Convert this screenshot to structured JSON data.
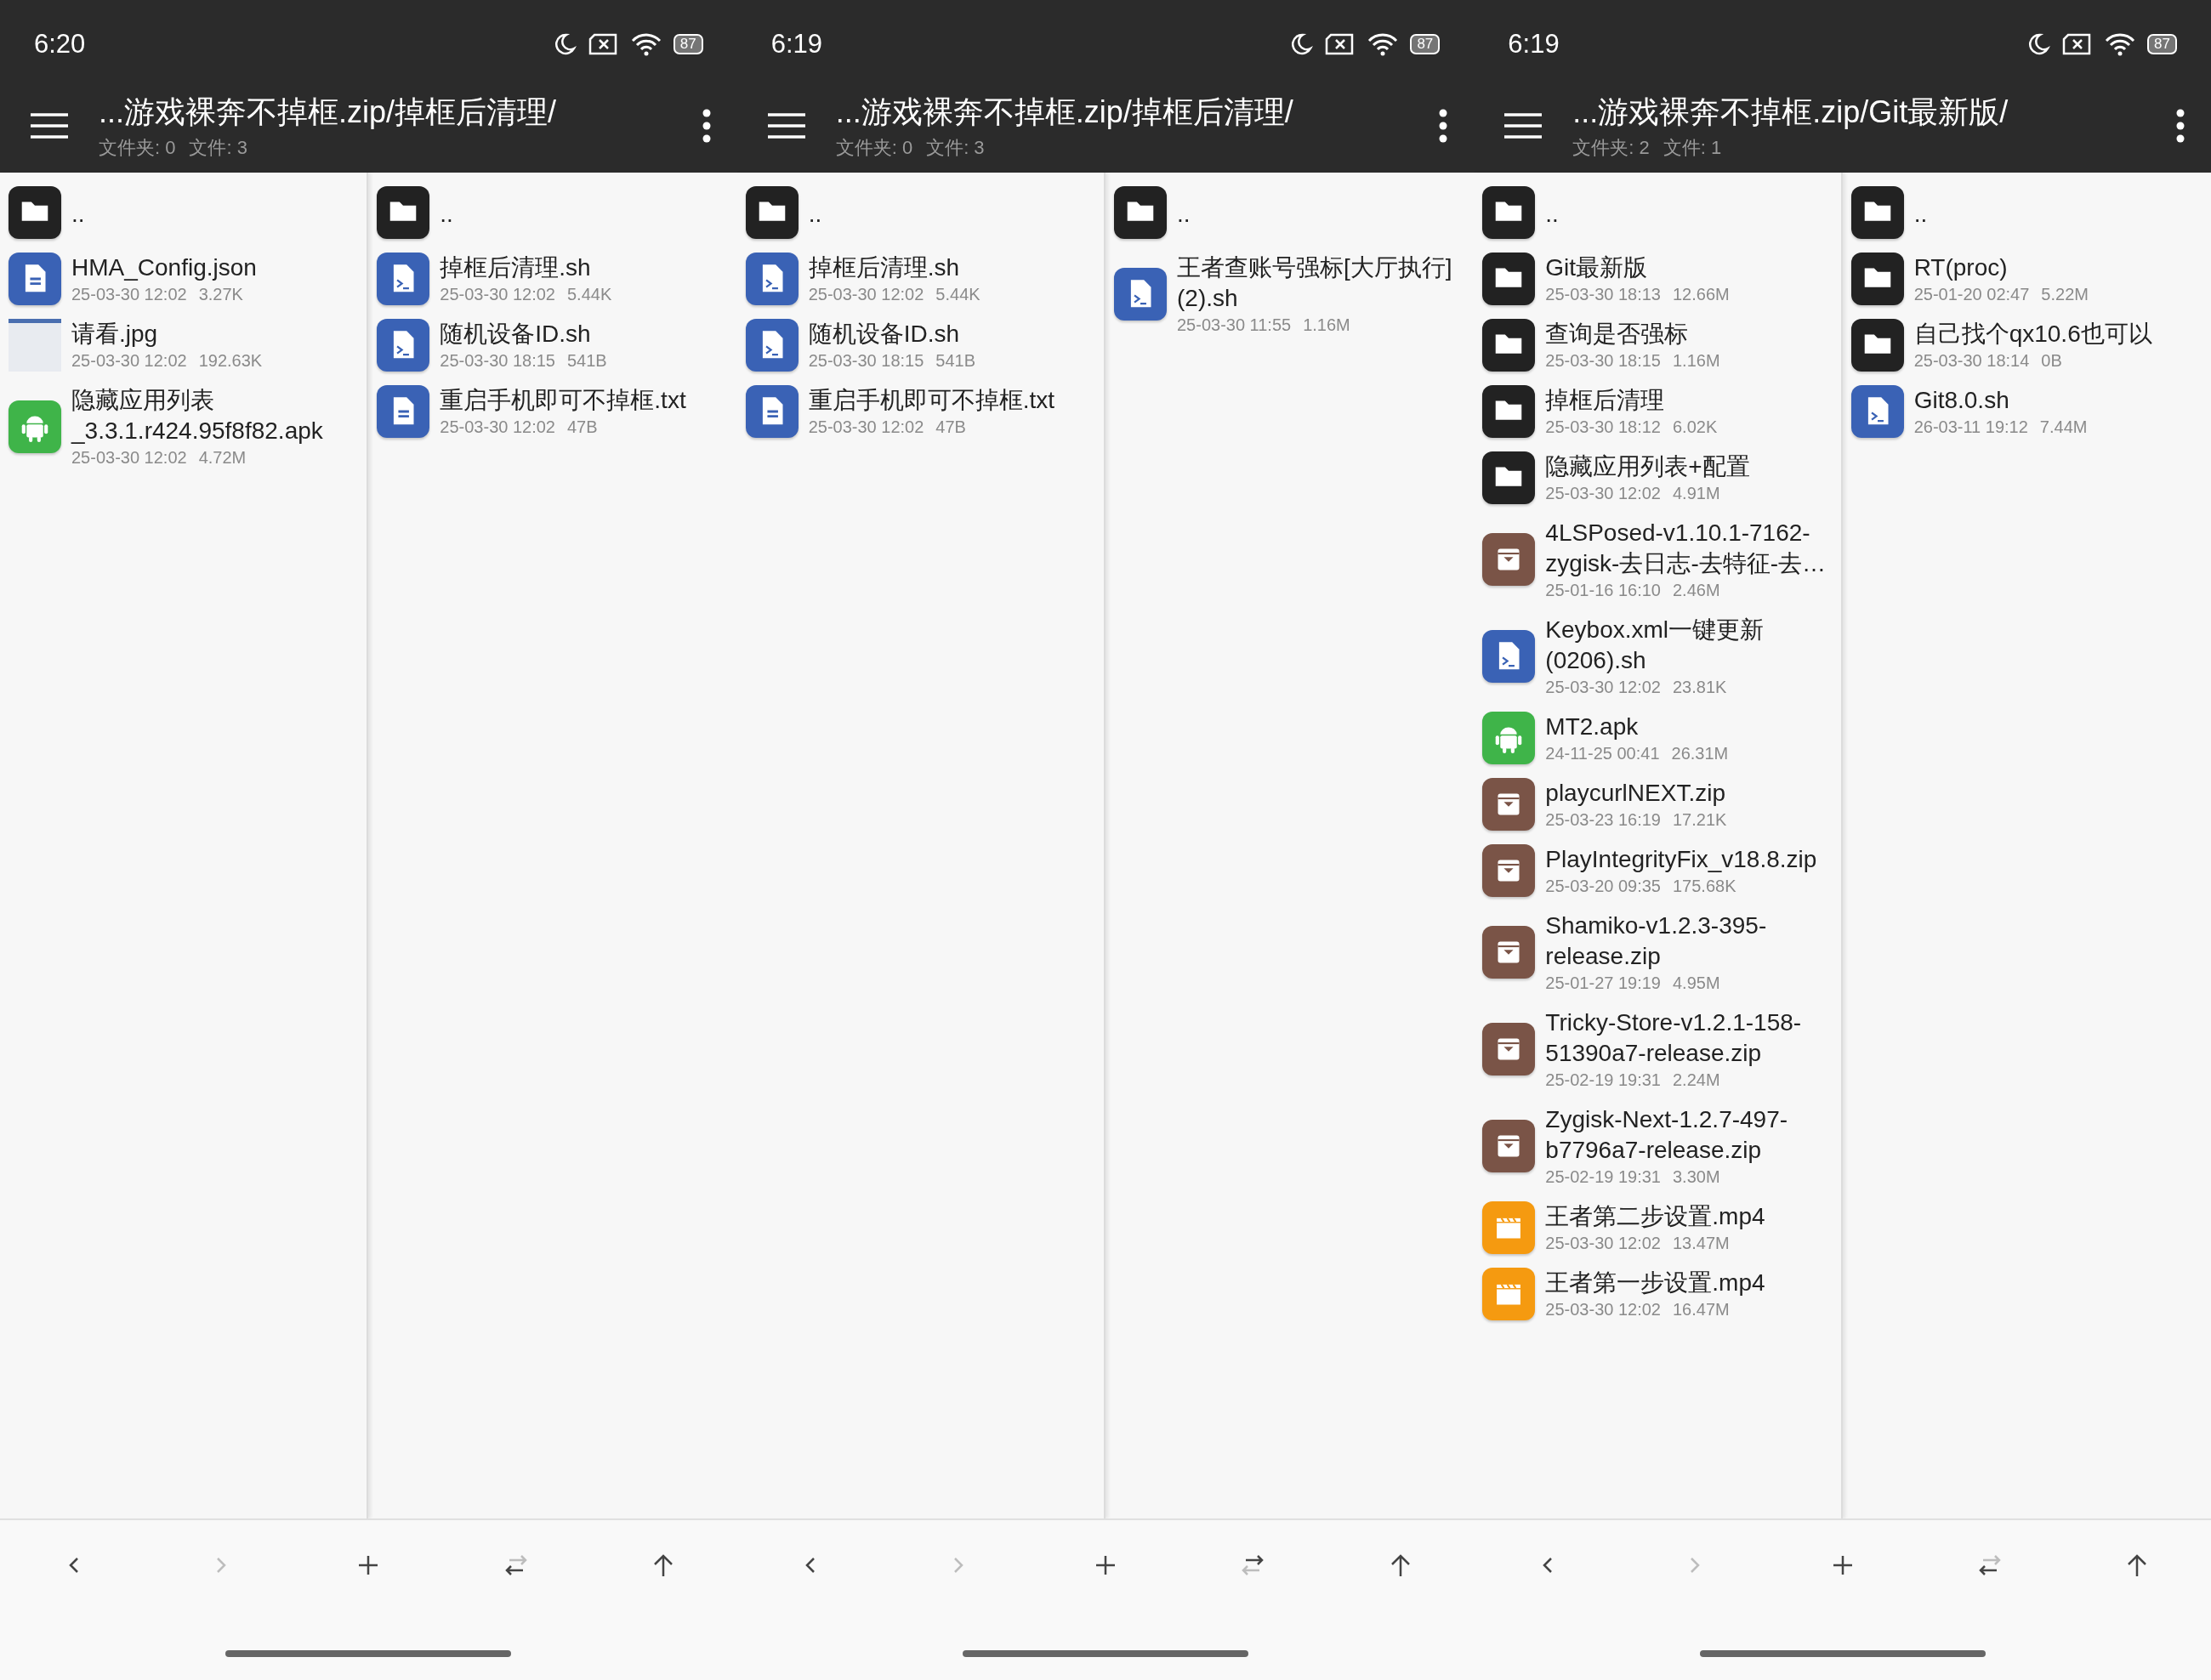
{
  "screens": [
    {
      "status_bar": {
        "time": "6:20",
        "battery": "87"
      },
      "toolbar": {
        "title": "...游戏裸奔不掉框.zip/掉框后清理/",
        "folders": "文件夹: 0",
        "files": "文件: 3"
      },
      "panes": [
        {
          "files": [
            {
              "name": "..",
              "kind": "folder"
            },
            {
              "name": "HMA_Config.json",
              "kind": "doc",
              "date": "25-03-30 12:02",
              "size": "3.27K"
            },
            {
              "name": "请看.jpg",
              "kind": "image",
              "date": "25-03-30 12:02",
              "size": "192.63K"
            },
            {
              "name": "隐藏应用列表_3.3.1.r424.95f8f82.apk",
              "kind": "apk",
              "date": "25-03-30 12:02",
              "size": "4.72M"
            }
          ]
        },
        {
          "files": [
            {
              "name": "..",
              "kind": "folder"
            },
            {
              "name": "掉框后清理.sh",
              "kind": "script",
              "date": "25-03-30 12:02",
              "size": "5.44K"
            },
            {
              "name": "随机设备ID.sh",
              "kind": "script",
              "date": "25-03-30 18:15",
              "size": "541B"
            },
            {
              "name": "重启手机即可不掉框.txt",
              "kind": "doc",
              "date": "25-03-30 12:02",
              "size": "47B"
            }
          ]
        }
      ],
      "nav": [
        {
          "kind": "back",
          "disabled": false
        },
        {
          "kind": "forward",
          "disabled": true
        },
        {
          "kind": "add"
        },
        {
          "kind": "swap",
          "right_pane_active": true
        },
        {
          "kind": "up"
        }
      ]
    },
    {
      "status_bar": {
        "time": "6:19",
        "battery": "87"
      },
      "toolbar": {
        "title": "...游戏裸奔不掉框.zip/掉框后清理/",
        "folders": "文件夹: 0",
        "files": "文件: 3"
      },
      "panes": [
        {
          "files": [
            {
              "name": "..",
              "kind": "folder"
            },
            {
              "name": "掉框后清理.sh",
              "kind": "script",
              "date": "25-03-30 12:02",
              "size": "5.44K"
            },
            {
              "name": "随机设备ID.sh",
              "kind": "script",
              "date": "25-03-30 18:15",
              "size": "541B"
            },
            {
              "name": "重启手机即可不掉框.txt",
              "kind": "doc",
              "date": "25-03-30 12:02",
              "size": "47B"
            }
          ]
        },
        {
          "files": [
            {
              "name": "..",
              "kind": "folder"
            },
            {
              "name": "王者查账号强标[大厅执行](2).sh",
              "kind": "script",
              "date": "25-03-30 11:55",
              "size": "1.16M"
            }
          ]
        }
      ],
      "nav": [
        {
          "kind": "back",
          "disabled": false
        },
        {
          "kind": "forward",
          "disabled": true
        },
        {
          "kind": "add"
        },
        {
          "kind": "swap",
          "right_pane_active": false
        },
        {
          "kind": "up"
        }
      ]
    },
    {
      "status_bar": {
        "time": "6:19",
        "battery": "87"
      },
      "toolbar": {
        "title": "...游戏裸奔不掉框.zip/Git最新版/",
        "folders": "文件夹: 2",
        "files": "文件: 1"
      },
      "panes": [
        {
          "files": [
            {
              "name": "..",
              "kind": "folder"
            },
            {
              "name": "Git最新版",
              "kind": "folder",
              "date": "25-03-30 18:13",
              "size": "12.66M"
            },
            {
              "name": "查询是否强标",
              "kind": "folder",
              "date": "25-03-30 18:15",
              "size": "1.16M"
            },
            {
              "name": "掉框后清理",
              "kind": "folder",
              "date": "25-03-30 18:12",
              "size": "6.02K"
            },
            {
              "name": "隐藏应用列表+配置",
              "kind": "folder",
              "date": "25-03-30 12:02",
              "size": "4.91M"
            },
            {
              "name": "4LSPosed-v1.10.1-7162-zygisk-去日志-去特征-去…",
              "kind": "archive",
              "date": "25-01-16 16:10",
              "size": "2.46M"
            },
            {
              "name": "Keybox.xml一键更新(0206).sh",
              "kind": "script",
              "date": "25-03-30 12:02",
              "size": "23.81K"
            },
            {
              "name": "MT2.apk",
              "kind": "apk",
              "date": "24-11-25 00:41",
              "size": "26.31M"
            },
            {
              "name": "playcurlNEXT.zip",
              "kind": "archive",
              "date": "25-03-23 16:19",
              "size": "17.21K"
            },
            {
              "name": "PlayIntegrityFix_v18.8.zip",
              "kind": "archive",
              "date": "25-03-20 09:35",
              "size": "175.68K"
            },
            {
              "name": "Shamiko-v1.2.3-395-release.zip",
              "kind": "archive",
              "date": "25-01-27 19:19",
              "size": "4.95M"
            },
            {
              "name": "Tricky-Store-v1.2.1-158-51390a7-release.zip",
              "kind": "archive",
              "date": "25-02-19 19:31",
              "size": "2.24M"
            },
            {
              "name": "Zygisk-Next-1.2.7-497-b7796a7-release.zip",
              "kind": "archive",
              "date": "25-02-19 19:31",
              "size": "3.30M"
            },
            {
              "name": "王者第二步设置.mp4",
              "kind": "video",
              "date": "25-03-30 12:02",
              "size": "13.47M"
            },
            {
              "name": "王者第一步设置.mp4",
              "kind": "video",
              "date": "25-03-30 12:02",
              "size": "16.47M"
            }
          ]
        },
        {
          "files": [
            {
              "name": "..",
              "kind": "folder"
            },
            {
              "name": "RT(proc)",
              "kind": "folder",
              "date": "25-01-20 02:47",
              "size": "5.22M"
            },
            {
              "name": "自己找个qx10.6也可以",
              "kind": "folder",
              "date": "25-03-30 18:14",
              "size": "0B"
            },
            {
              "name": "Git8.0.sh",
              "kind": "script",
              "date": "26-03-11 19:12",
              "size": "7.44M"
            }
          ]
        }
      ],
      "nav": [
        {
          "kind": "back",
          "disabled": false
        },
        {
          "kind": "forward",
          "disabled": true
        },
        {
          "kind": "add"
        },
        {
          "kind": "swap",
          "right_pane_active": true
        },
        {
          "kind": "up"
        }
      ]
    }
  ]
}
